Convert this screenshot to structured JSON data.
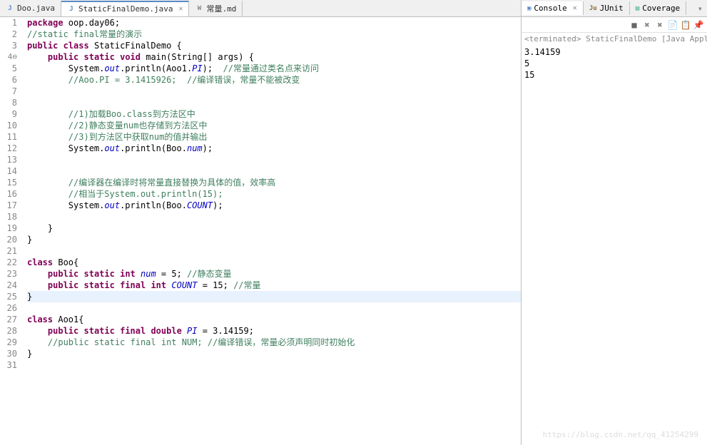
{
  "editor": {
    "tabs": [
      {
        "label": "Doo.java",
        "active": false
      },
      {
        "label": "StaticFinalDemo.java",
        "active": true
      },
      {
        "label": "常量.md",
        "active": false
      }
    ],
    "lines": [
      {
        "n": "1",
        "tokens": [
          [
            "kw",
            "package"
          ],
          [
            "normal",
            " oop.day06;"
          ]
        ]
      },
      {
        "n": "2",
        "tokens": [
          [
            "comment",
            "//static final常量的演示"
          ]
        ]
      },
      {
        "n": "3",
        "tokens": [
          [
            "kw",
            "public"
          ],
          [
            "normal",
            " "
          ],
          [
            "kw",
            "class"
          ],
          [
            "normal",
            " StaticFinalDemo {"
          ]
        ]
      },
      {
        "n": "4",
        "fold": true,
        "tokens": [
          [
            "normal",
            "    "
          ],
          [
            "kw",
            "public"
          ],
          [
            "normal",
            " "
          ],
          [
            "kw",
            "static"
          ],
          [
            "normal",
            " "
          ],
          [
            "kw",
            "void"
          ],
          [
            "normal",
            " main(String[] args) {"
          ]
        ]
      },
      {
        "n": "5",
        "tokens": [
          [
            "normal",
            "        System."
          ],
          [
            "field",
            "out"
          ],
          [
            "normal",
            ".println(Aoo1."
          ],
          [
            "static-field",
            "PI"
          ],
          [
            "normal",
            ");  "
          ],
          [
            "comment",
            "//常量通过类名点来访问"
          ]
        ]
      },
      {
        "n": "6",
        "tokens": [
          [
            "normal",
            "        "
          ],
          [
            "comment",
            "//Aoo.PI = 3.1415926;  //编译错误，常量不能被改变"
          ]
        ]
      },
      {
        "n": "7",
        "tokens": []
      },
      {
        "n": "8",
        "tokens": []
      },
      {
        "n": "9",
        "tokens": [
          [
            "normal",
            "        "
          ],
          [
            "comment",
            "//1)加载Boo.class到方法区中"
          ]
        ]
      },
      {
        "n": "10",
        "tokens": [
          [
            "normal",
            "        "
          ],
          [
            "comment",
            "//2)静态变量num也存储到方法区中"
          ]
        ]
      },
      {
        "n": "11",
        "tokens": [
          [
            "normal",
            "        "
          ],
          [
            "comment",
            "//3)到方法区中获取num的值并输出"
          ]
        ]
      },
      {
        "n": "12",
        "tokens": [
          [
            "normal",
            "        System."
          ],
          [
            "field",
            "out"
          ],
          [
            "normal",
            ".println(Boo."
          ],
          [
            "static-field",
            "num"
          ],
          [
            "normal",
            ");"
          ]
        ]
      },
      {
        "n": "13",
        "tokens": []
      },
      {
        "n": "14",
        "tokens": []
      },
      {
        "n": "15",
        "tokens": [
          [
            "normal",
            "        "
          ],
          [
            "comment",
            "//编译器在编译时将常量直接替换为具体的值，效率高"
          ]
        ]
      },
      {
        "n": "16",
        "tokens": [
          [
            "normal",
            "        "
          ],
          [
            "comment",
            "//相当于System.out.println(15);"
          ]
        ]
      },
      {
        "n": "17",
        "tokens": [
          [
            "normal",
            "        System."
          ],
          [
            "field",
            "out"
          ],
          [
            "normal",
            ".println(Boo."
          ],
          [
            "static-field",
            "COUNT"
          ],
          [
            "normal",
            ");"
          ]
        ]
      },
      {
        "n": "18",
        "tokens": []
      },
      {
        "n": "19",
        "tokens": [
          [
            "normal",
            "    }"
          ]
        ]
      },
      {
        "n": "20",
        "tokens": [
          [
            "normal",
            "}"
          ]
        ]
      },
      {
        "n": "21",
        "tokens": []
      },
      {
        "n": "22",
        "tokens": [
          [
            "kw",
            "class"
          ],
          [
            "normal",
            " Boo{"
          ]
        ]
      },
      {
        "n": "23",
        "tokens": [
          [
            "normal",
            "    "
          ],
          [
            "kw",
            "public"
          ],
          [
            "normal",
            " "
          ],
          [
            "kw",
            "static"
          ],
          [
            "normal",
            " "
          ],
          [
            "kw",
            "int"
          ],
          [
            "normal",
            " "
          ],
          [
            "static-field",
            "num"
          ],
          [
            "normal",
            " = 5; "
          ],
          [
            "comment",
            "//静态变量"
          ]
        ]
      },
      {
        "n": "24",
        "tokens": [
          [
            "normal",
            "    "
          ],
          [
            "kw",
            "public"
          ],
          [
            "normal",
            " "
          ],
          [
            "kw",
            "static"
          ],
          [
            "normal",
            " "
          ],
          [
            "kw",
            "final"
          ],
          [
            "normal",
            " "
          ],
          [
            "kw",
            "int"
          ],
          [
            "normal",
            " "
          ],
          [
            "static-field",
            "COUNT"
          ],
          [
            "normal",
            " = 15; "
          ],
          [
            "comment",
            "//常量"
          ]
        ]
      },
      {
        "n": "25",
        "highlight": true,
        "tokens": [
          [
            "normal",
            "}"
          ]
        ]
      },
      {
        "n": "26",
        "tokens": []
      },
      {
        "n": "27",
        "tokens": [
          [
            "kw",
            "class"
          ],
          [
            "normal",
            " Aoo1{"
          ]
        ]
      },
      {
        "n": "28",
        "tokens": [
          [
            "normal",
            "    "
          ],
          [
            "kw",
            "public"
          ],
          [
            "normal",
            " "
          ],
          [
            "kw",
            "static"
          ],
          [
            "normal",
            " "
          ],
          [
            "kw",
            "final"
          ],
          [
            "normal",
            " "
          ],
          [
            "kw",
            "double"
          ],
          [
            "normal",
            " "
          ],
          [
            "static-field",
            "PI"
          ],
          [
            "normal",
            " = 3.14159;"
          ]
        ]
      },
      {
        "n": "29",
        "tokens": [
          [
            "normal",
            "    "
          ],
          [
            "comment",
            "//public static final int NUM; //编译错误，常量必须声明同时初始化"
          ]
        ]
      },
      {
        "n": "30",
        "tokens": [
          [
            "normal",
            "}"
          ]
        ]
      },
      {
        "n": "31",
        "tokens": []
      }
    ]
  },
  "console": {
    "tabs": [
      {
        "label": "Console",
        "active": true
      },
      {
        "label": "JUnit",
        "active": false
      },
      {
        "label": "Coverage",
        "active": false
      }
    ],
    "status": "<terminated> StaticFinalDemo [Java Applicat",
    "output": [
      "3.14159",
      "5",
      "15"
    ]
  },
  "watermark": "https://blog.csdn.net/qq_41254299"
}
